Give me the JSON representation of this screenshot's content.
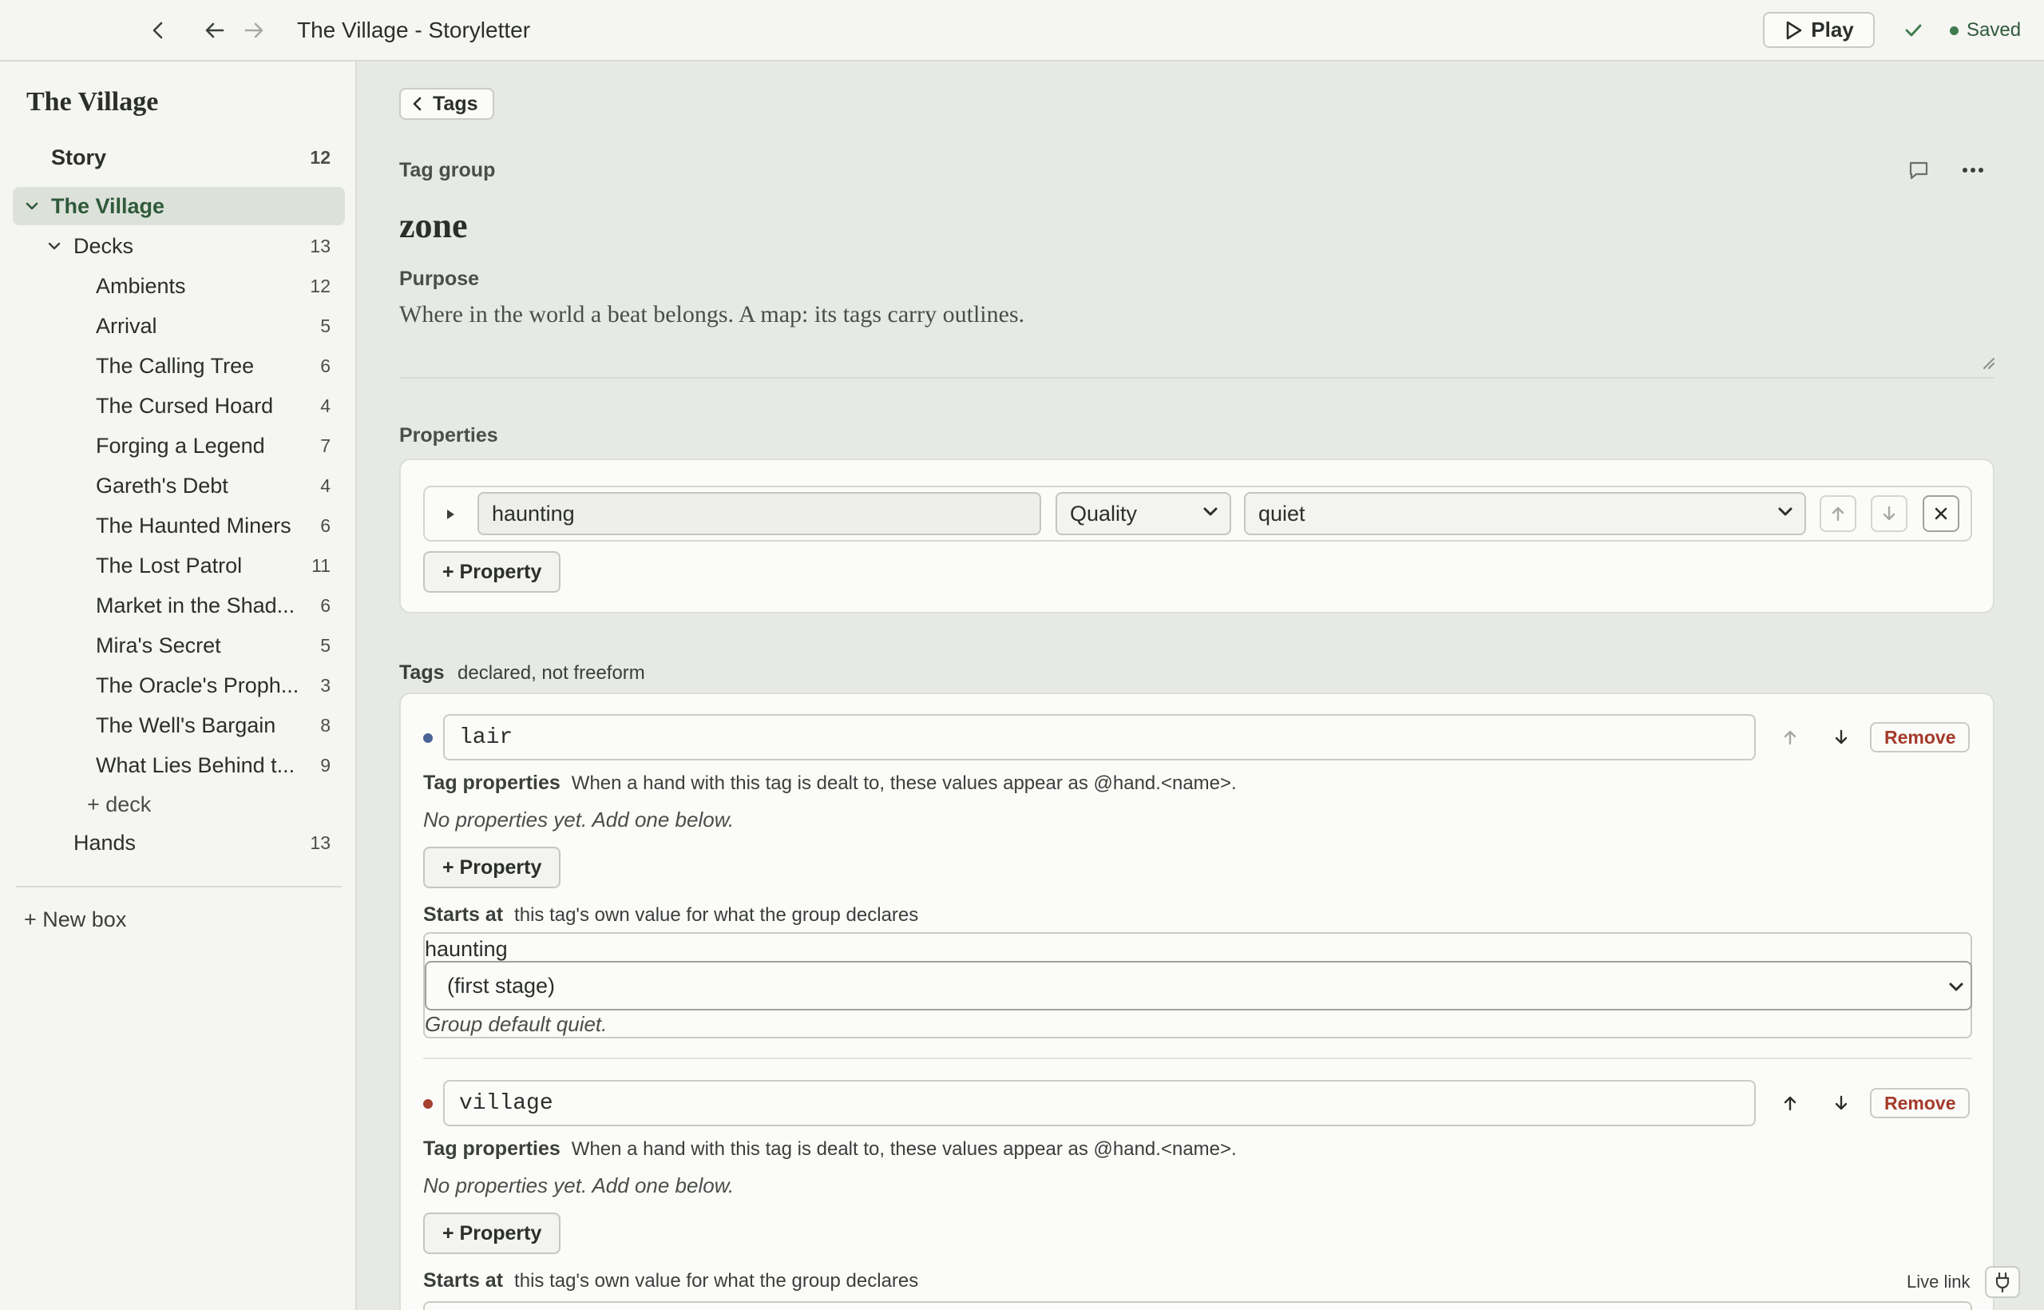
{
  "window": {
    "title": "The Village - Storyletter"
  },
  "topbar": {
    "play_label": "Play",
    "saved_label": "Saved"
  },
  "sidebar": {
    "title": "The Village",
    "story": {
      "label": "Story",
      "count": "12"
    },
    "box": {
      "label": "The Village"
    },
    "decks": {
      "label": "Decks",
      "count": "13"
    },
    "deck_items": [
      {
        "label": "Ambients",
        "count": "12"
      },
      {
        "label": "Arrival",
        "count": "5"
      },
      {
        "label": "The Calling Tree",
        "count": "6"
      },
      {
        "label": "The Cursed Hoard",
        "count": "4"
      },
      {
        "label": "Forging a Legend",
        "count": "7"
      },
      {
        "label": "Gareth's Debt",
        "count": "4"
      },
      {
        "label": "The Haunted Miners",
        "count": "6"
      },
      {
        "label": "The Lost Patrol",
        "count": "11"
      },
      {
        "label": "Market in the Shad...",
        "count": "6"
      },
      {
        "label": "Mira's Secret",
        "count": "5"
      },
      {
        "label": "The Oracle's Proph...",
        "count": "3"
      },
      {
        "label": "The Well's Bargain",
        "count": "8"
      },
      {
        "label": "What Lies Behind t...",
        "count": "9"
      }
    ],
    "add_deck": "+ deck",
    "hands": {
      "label": "Hands",
      "count": "13"
    },
    "new_box": "+ New box"
  },
  "main": {
    "back_label": "Tags",
    "tag_group_label": "Tag group",
    "group_name": "zone",
    "purpose_label": "Purpose",
    "purpose_text": "Where in the world a beat belongs. A map: its tags carry outlines.",
    "properties_label": "Properties",
    "property": {
      "name": "haunting",
      "kind": "Quality",
      "value": "quiet"
    },
    "add_property": "+ Property",
    "tags_label": "Tags",
    "tags_hint": "declared, not freeform",
    "tag_props_label": "Tag properties",
    "tag_props_hint": "When a hand with this tag is dealt to, these values appear as @hand.<name>.",
    "no_props": "No properties yet. Add one below.",
    "starts_label": "Starts at",
    "starts_hint": "this tag's own value for what the group declares",
    "remove_label": "Remove",
    "tags": [
      {
        "name": "lair",
        "color": "#4a6496",
        "starts_quality": "haunting",
        "starts_value": "(first stage)",
        "group_default": "Group default quiet."
      },
      {
        "name": "village",
        "color": "#a3412e"
      }
    ],
    "live_link": "Live link"
  }
}
